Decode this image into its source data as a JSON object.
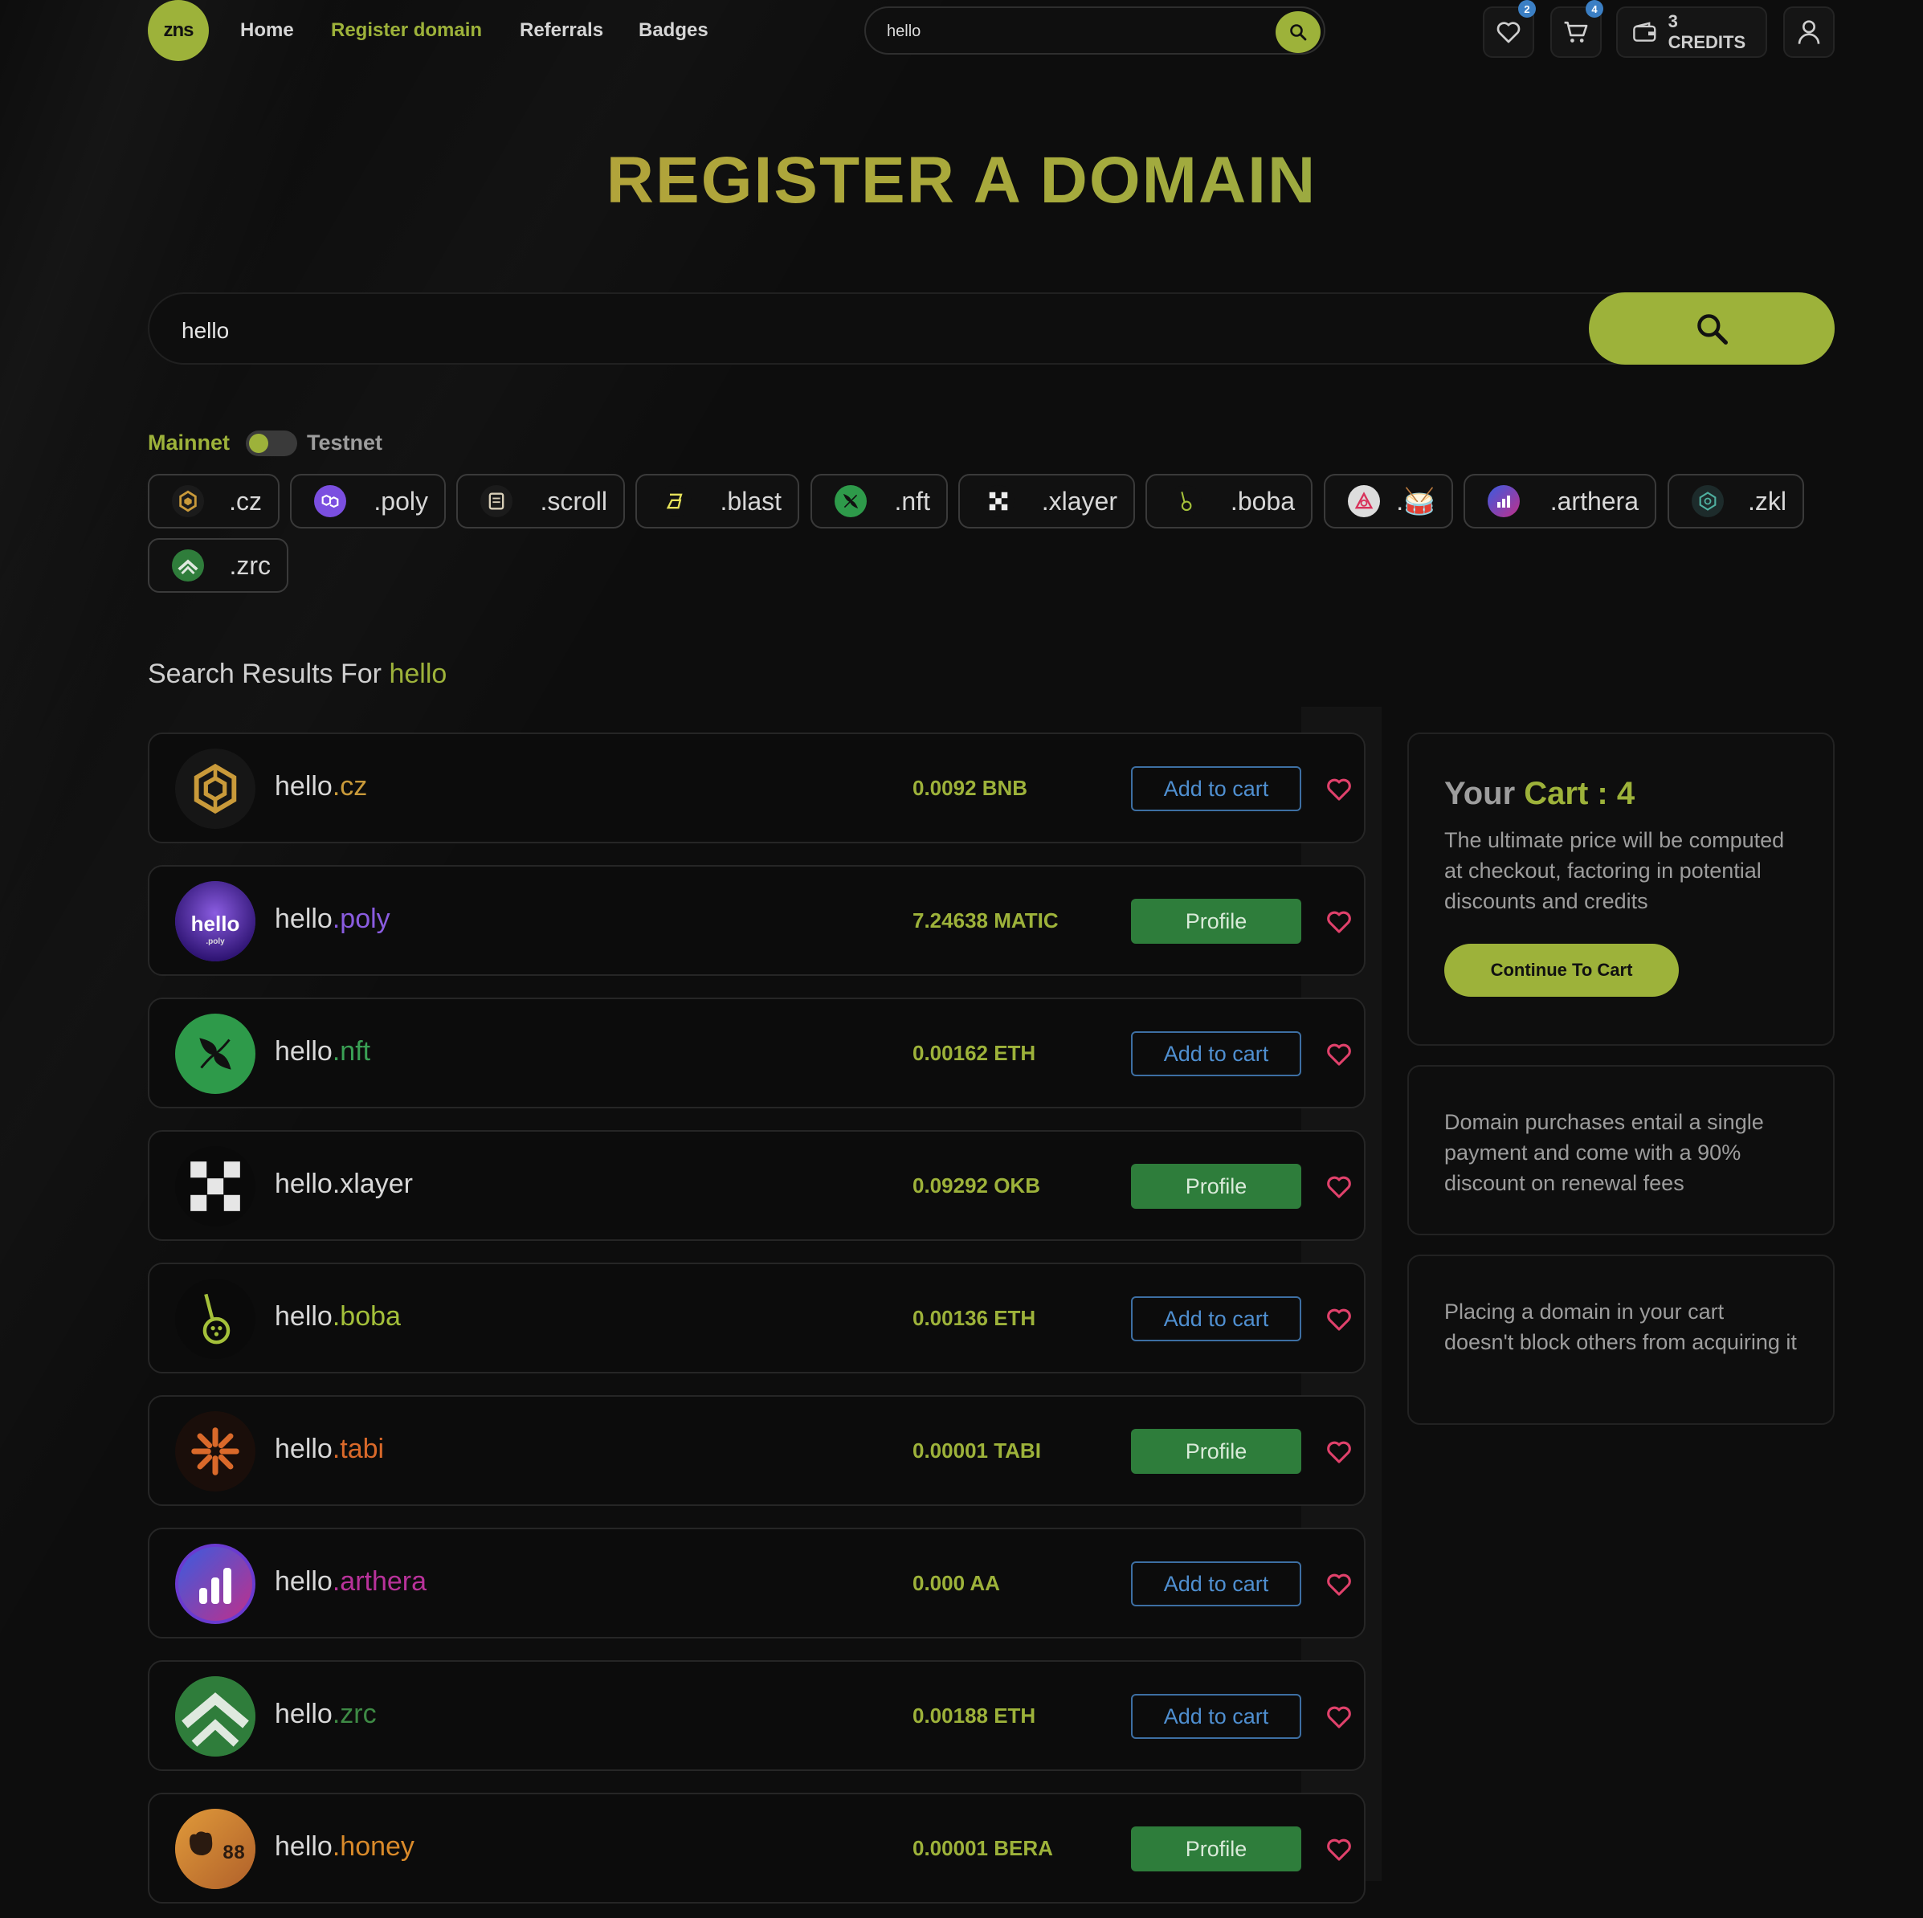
{
  "nav": {
    "logo_text": "zns",
    "links": [
      "Home",
      "Register domain",
      "Referrals",
      "Badges"
    ],
    "search_value": "hello",
    "wishlist_count": "2",
    "cart_count": "4",
    "credits": "3 CREDITS"
  },
  "hero": {
    "title": "REGISTER A DOMAIN",
    "search_value": "hello"
  },
  "network": {
    "mainnet_label": "Mainnet",
    "testnet_label": "Testnet",
    "selected": "Mainnet"
  },
  "tlds": [
    {
      "label": ".cz",
      "icon": "binance-icon",
      "color": "#1b1b1b"
    },
    {
      "label": ".poly",
      "icon": "polygon-icon",
      "color": "#7b4fe0"
    },
    {
      "label": ".scroll",
      "icon": "scroll-icon",
      "color": "#1b1b1b"
    },
    {
      "label": ".blast",
      "icon": "blast-icon",
      "color": "#111111"
    },
    {
      "label": ".nft",
      "icon": "leaf-icon",
      "color": "#2e9a4a"
    },
    {
      "label": ".xlayer",
      "icon": "checker-icon",
      "color": "#111111"
    },
    {
      "label": ".boba",
      "icon": "boba-icon",
      "color": "#111111"
    },
    {
      "label": ".🥁",
      "icon": "triangle-icon",
      "color": "#dddddd"
    },
    {
      "label": ".arthera",
      "icon": "arthera-icon",
      "color": "#5a3fd0"
    },
    {
      "label": ".zkl",
      "icon": "zkl-icon",
      "color": "#1d2b2b"
    },
    {
      "label": ".zrc",
      "icon": "zrc-icon",
      "color": "#2f7d3b"
    }
  ],
  "results": {
    "heading_prefix": "Search Results For",
    "query": "hello",
    "rows": [
      {
        "base": "hello",
        "tld": ".cz",
        "tld_color": "#c99a3a",
        "price": "0.0092 BNB",
        "action": "Add to cart",
        "avatar": "binance-icon",
        "avatar_color": "#161616"
      },
      {
        "base": "hello",
        "tld": ".poly",
        "tld_color": "#8a5ce0",
        "price": "7.24638 MATIC",
        "action": "Profile",
        "avatar": "poly-avatar",
        "avatar_color": "#4a2aa0"
      },
      {
        "base": "hello",
        "tld": ".nft",
        "tld_color": "#3aa155",
        "price": "0.00162 ETH",
        "action": "Add to cart",
        "avatar": "leaf-icon",
        "avatar_color": "#2e9a4a"
      },
      {
        "base": "hello",
        "tld": ".xlayer",
        "tld_color": "#d8d8d8",
        "price": "0.09292 OKB",
        "action": "Profile",
        "avatar": "checker-icon",
        "avatar_color": "#0a0a0a"
      },
      {
        "base": "hello",
        "tld": ".boba",
        "tld_color": "#a4c03a",
        "price": "0.00136 ETH",
        "action": "Add to cart",
        "avatar": "boba-icon",
        "avatar_color": "#0a0a0a"
      },
      {
        "base": "hello",
        "tld": ".tabi",
        "tld_color": "#d9692a",
        "price": "0.00001 TABI",
        "action": "Profile",
        "avatar": "tabi-icon",
        "avatar_color": "#1a0e0a"
      },
      {
        "base": "hello",
        "tld": ".arthera",
        "tld_color": "#b8329a",
        "price": "0.000 AA",
        "action": "Add to cart",
        "avatar": "arthera-icon",
        "avatar_color": "#6a3bd0"
      },
      {
        "base": "hello",
        "tld": ".zrc",
        "tld_color": "#3e8a45",
        "price": "0.00188 ETH",
        "action": "Add to cart",
        "avatar": "zrc-icon",
        "avatar_color": "#2f7d3b"
      },
      {
        "base": "hello",
        "tld": ".honey",
        "tld_color": "#d98a2a",
        "price": "0.00001 BERA",
        "action": "Profile",
        "avatar": "bera-icon",
        "avatar_color": "#c47a2a"
      }
    ]
  },
  "cart_panel": {
    "title_prefix": "Your",
    "title_suffix": "Cart : 4",
    "description": "The ultimate price will be computed at checkout, factoring in potential discounts and credits",
    "button": "Continue To Cart"
  },
  "info_panels": [
    "Domain purchases entail a single payment and come with a 90% discount on renewal fees",
    "Placing a domain in your cart doesn't block others from acquiring it"
  ],
  "colors": {
    "accent": "#9db23a",
    "cart_button_border": "#3d6fa3",
    "profile_button_bg": "#2e7d3b",
    "heart": "#e0416b"
  }
}
